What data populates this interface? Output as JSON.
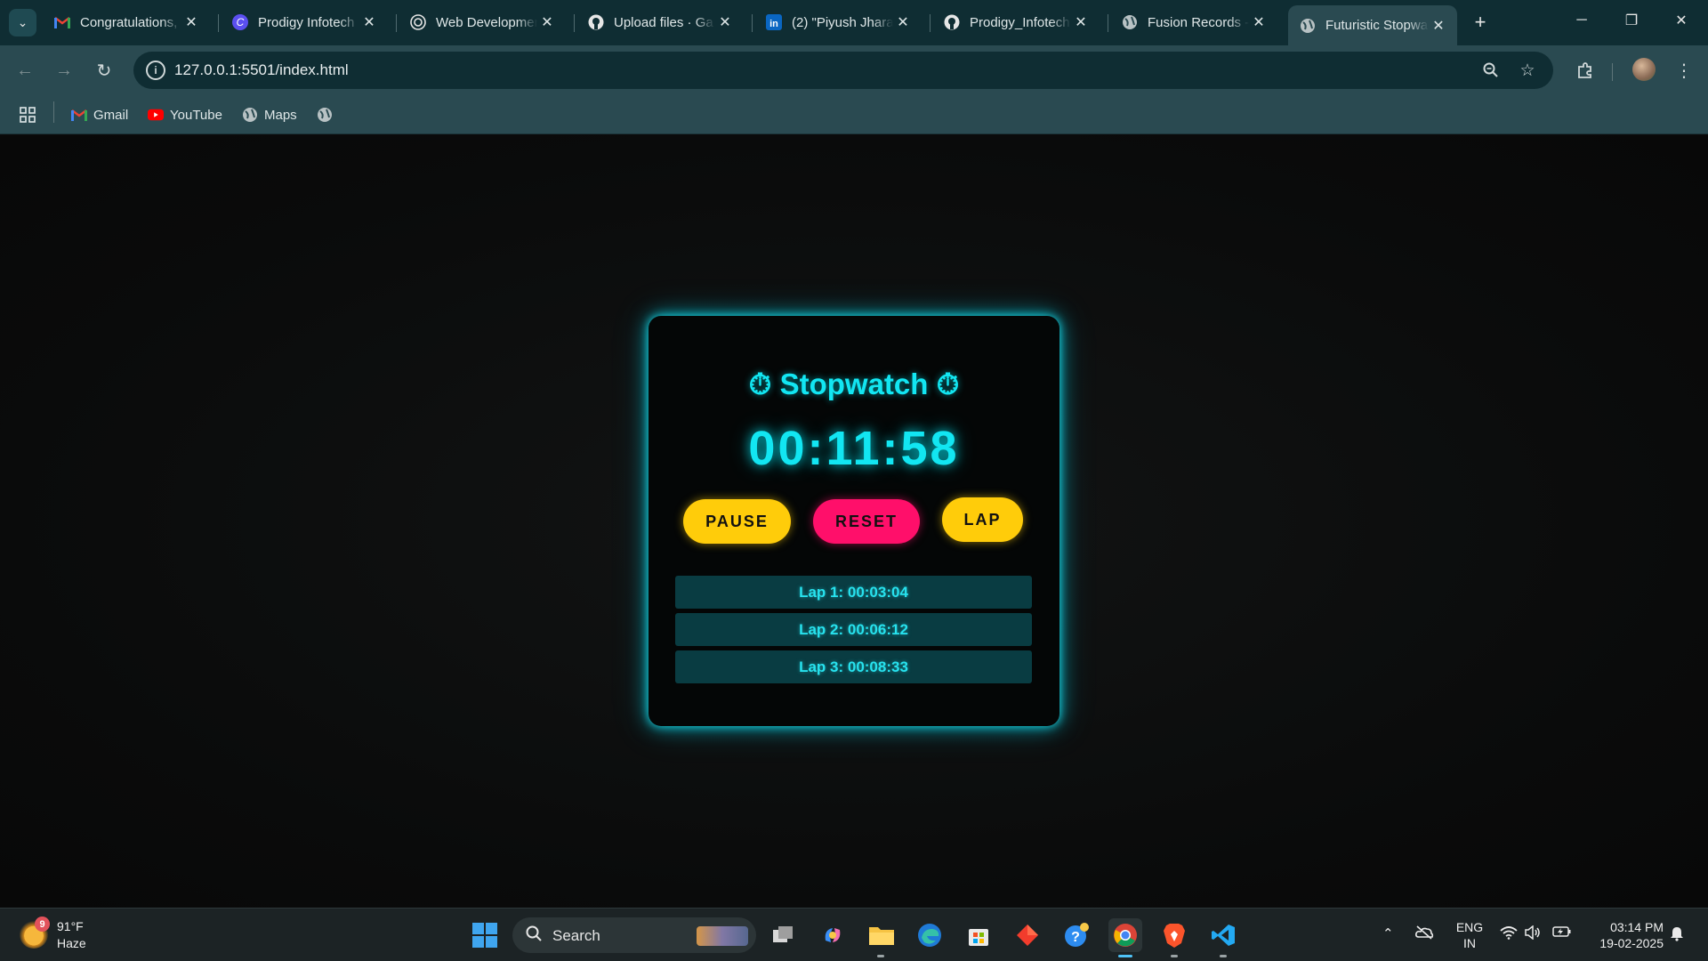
{
  "browser": {
    "tabs": [
      {
        "title": "Congratulations,",
        "icon": "gmail-icon"
      },
      {
        "title": "Prodigy Infotech",
        "icon": "canva-icon"
      },
      {
        "title": "Web Development",
        "icon": "openai-icon"
      },
      {
        "title": "Upload files · Ga",
        "icon": "github-icon"
      },
      {
        "title": "(2) \"Piyush Jhara",
        "icon": "linkedin-icon"
      },
      {
        "title": "Prodigy_Infotech",
        "icon": "github-icon"
      },
      {
        "title": "Fusion Records -",
        "icon": "globe-icon"
      },
      {
        "title": "Futuristic Stopwa",
        "icon": "globe-icon",
        "active": true
      }
    ],
    "url": "127.0.0.1:5501/index.html",
    "bookmarks": [
      {
        "label": "Gmail",
        "icon": "gmail-icon"
      },
      {
        "label": "YouTube",
        "icon": "youtube-icon"
      },
      {
        "label": "Maps",
        "icon": "globe-icon"
      },
      {
        "label": "",
        "icon": "globe-icon"
      }
    ]
  },
  "stopwatch": {
    "title": "⏱ Stopwatch ⏱",
    "time": "00:11:58",
    "buttons": {
      "pause": "PAUSE",
      "reset": "RESET",
      "lap": "LAP"
    },
    "laps": [
      "Lap 1: 00:03:04",
      "Lap 2: 00:06:12",
      "Lap 3: 00:08:33"
    ]
  },
  "taskbar": {
    "weather": {
      "badge": "9",
      "temp": "91°F",
      "condition": "Haze"
    },
    "search_label": "Search",
    "language": {
      "line1": "ENG",
      "line2": "IN"
    },
    "clock": {
      "time": "03:14 PM",
      "date": "19-02-2025"
    }
  },
  "colors": {
    "accent_cyan": "#12e6f2",
    "pause_yellow": "#ffcc0a",
    "reset_pink": "#ff0f6a",
    "lap_row_bg": "#093c42"
  }
}
